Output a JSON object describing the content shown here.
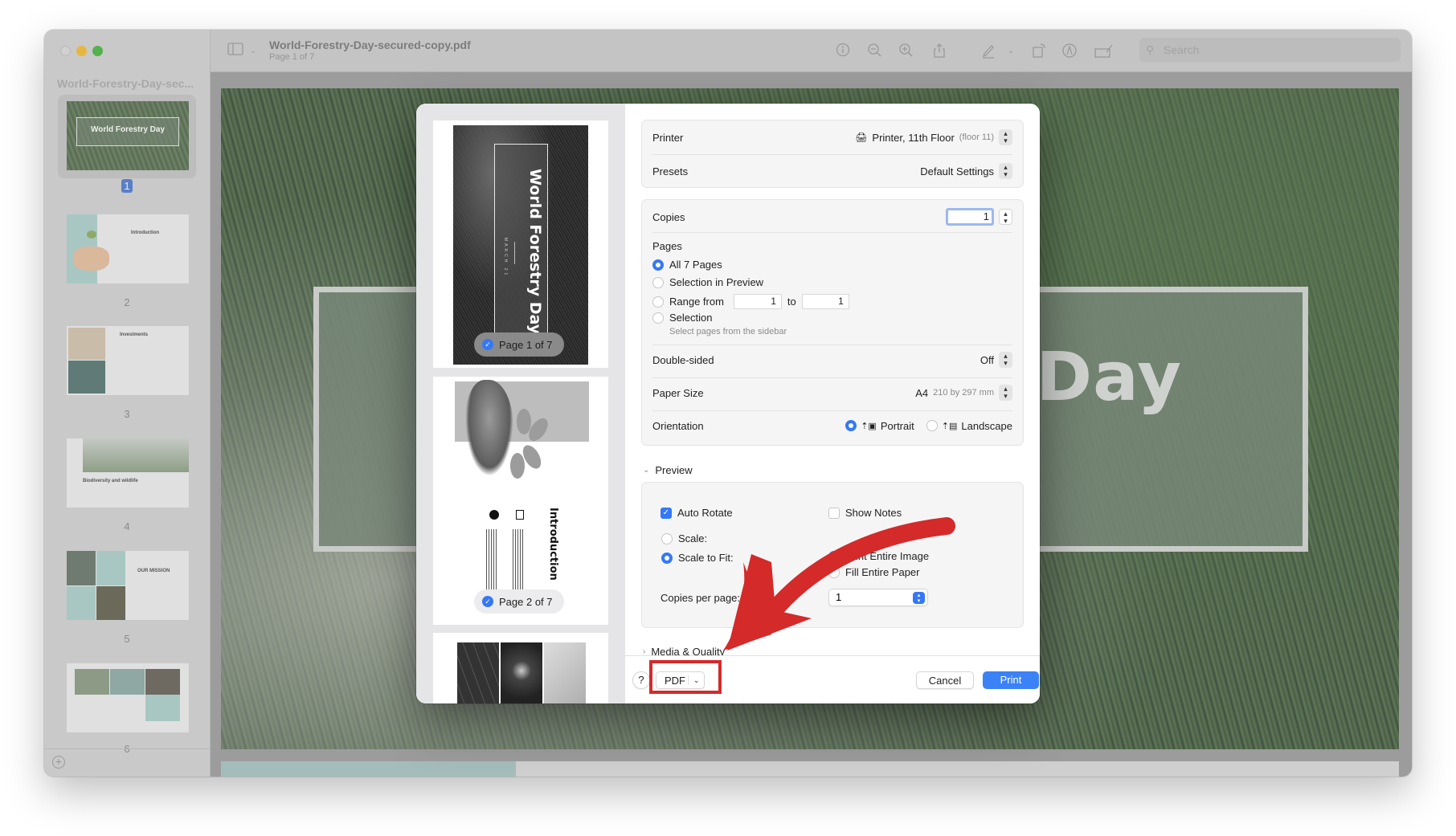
{
  "window": {
    "title": "World-Forestry-Day-secured-copy.pdf",
    "subtitle": "Page 1 of 7",
    "sidebar_title": "World-Forestry-Day-sec...",
    "search_placeholder": "Search",
    "toolbar_icons": [
      "sidebar-toggle-icon",
      "info-icon",
      "zoom-out-icon",
      "zoom-in-icon",
      "share-icon",
      "markup-pen-icon",
      "rotate-icon",
      "markup-circle-icon",
      "signature-icon"
    ]
  },
  "sidebar": {
    "thumbnails": [
      {
        "number": "1",
        "title": "World Forestry Day",
        "selected": true
      },
      {
        "number": "2",
        "title": "Introduction"
      },
      {
        "number": "3",
        "title": "Investments"
      },
      {
        "number": "4",
        "title": "Biodiversity and wildlife"
      },
      {
        "number": "5",
        "title": "OUR MISSION"
      },
      {
        "number": "6",
        "title": ""
      }
    ]
  },
  "document": {
    "visible_title": "Day",
    "scroll_position": 0.25
  },
  "print_dialog": {
    "preview_pages": [
      {
        "title": "World Forestry Day",
        "subtitle": "MARCH 21",
        "badge": "Page 1 of 7",
        "checked": true
      },
      {
        "title": "Introduction",
        "badge": "Page 2 of 7",
        "checked": true
      },
      {
        "title": "",
        "badge": ""
      }
    ],
    "printer": {
      "label": "Printer",
      "value": "Printer, 11th Floor",
      "detail": "(floor 11)"
    },
    "presets": {
      "label": "Presets",
      "value": "Default Settings"
    },
    "copies": {
      "label": "Copies",
      "value": "1"
    },
    "pages": {
      "label": "Pages",
      "options": [
        {
          "label": "All 7 Pages",
          "selected": true
        },
        {
          "label": "Selection in Preview",
          "selected": false
        },
        {
          "label": "Range from",
          "selected": false
        },
        {
          "label": "Selection",
          "selected": false
        }
      ],
      "range_from": "1",
      "range_to_label": "to",
      "range_to": "1",
      "selection_hint": "Select pages from the sidebar"
    },
    "double_sided": {
      "label": "Double-sided",
      "value": "Off"
    },
    "paper_size": {
      "label": "Paper Size",
      "value": "A4",
      "detail": "210 by 297 mm"
    },
    "orientation": {
      "label": "Orientation",
      "portrait": "Portrait",
      "landscape": "Landscape",
      "selected": "Portrait"
    },
    "preview_section": {
      "label": "Preview",
      "auto_rotate": {
        "label": "Auto Rotate",
        "checked": true
      },
      "show_notes": {
        "label": "Show Notes",
        "checked": false
      },
      "scale": {
        "label": "Scale:",
        "selected": false
      },
      "scale_to_fit": {
        "label": "Scale to Fit:",
        "selected": true
      },
      "print_entire_image": {
        "label": "Print Entire Image",
        "selected": true
      },
      "fill_entire_paper": {
        "label": "Fill Entire Paper",
        "selected": false
      },
      "copies_per_page": {
        "label": "Copies per page:",
        "value": "1"
      }
    },
    "media_quality": {
      "label": "Media & Quality"
    },
    "footer": {
      "help": "?",
      "pdf": "PDF",
      "cancel": "Cancel",
      "print": "Print"
    }
  },
  "annotation": {
    "color": "#d42a2a",
    "target": "PDF button"
  }
}
